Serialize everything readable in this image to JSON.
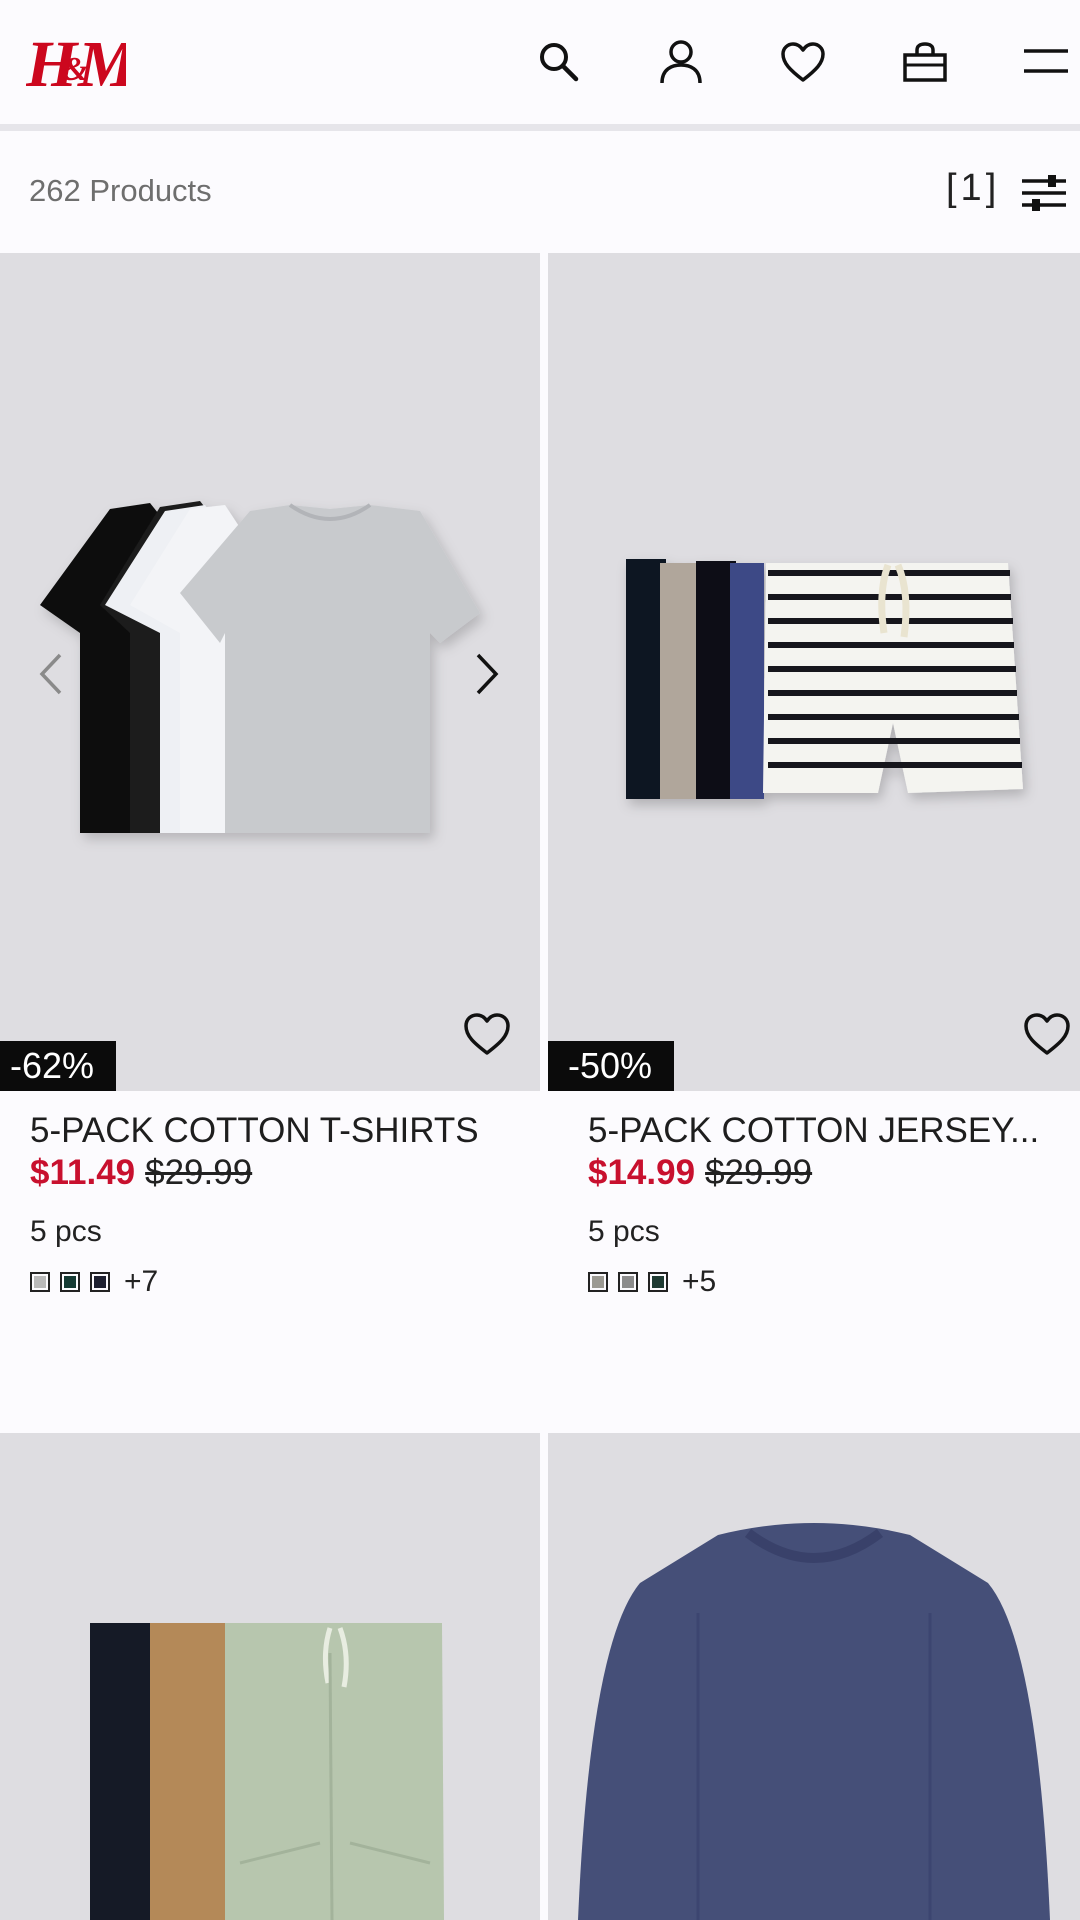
{
  "header": {
    "logo_text": "H&M",
    "icons": [
      "search-icon",
      "account-icon",
      "heart-icon",
      "bag-icon",
      "menu-icon"
    ]
  },
  "bar": {
    "count": "262 Products",
    "filter_count": "[1]"
  },
  "products": [
    {
      "badge": "-62%",
      "title": "5-PACK COTTON T-SHIRTS",
      "sale_price": "$11.49",
      "old_price": "$29.99",
      "pcs": "5 pcs",
      "swatch_colors": [
        "#b9b9b9",
        "#153a33",
        "#1e2030"
      ],
      "more_colors": "+7"
    },
    {
      "badge": "-50%",
      "title": "5-PACK COTTON JERSEY...",
      "sale_price": "$14.99",
      "old_price": "$29.99",
      "pcs": "5 pcs",
      "swatch_colors": [
        "#9c9a93",
        "#8c8c8c",
        "#1f3b33"
      ],
      "more_colors": "+5"
    }
  ],
  "colors": {
    "sale": "#c8102e",
    "image_bg": "#dedde1",
    "badge_bg": "#0b0b0b",
    "logo": "#cc071e"
  }
}
